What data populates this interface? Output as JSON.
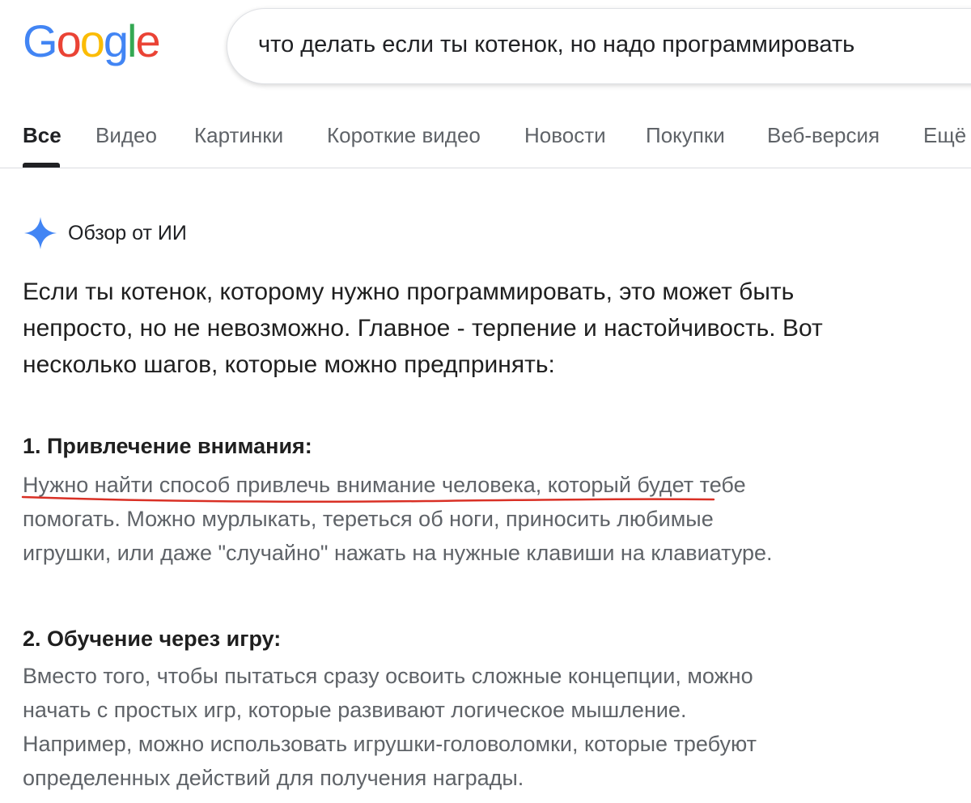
{
  "logo": {
    "letters": [
      "G",
      "o",
      "o",
      "g",
      "l",
      "e"
    ],
    "colors": [
      "#4285F4",
      "#EA4335",
      "#FBBC05",
      "#4285F4",
      "#34A853",
      "#EA4335"
    ]
  },
  "search": {
    "query": "что делать если ты котенок, но надо программировать"
  },
  "tabs": [
    {
      "label": "Все",
      "active": true
    },
    {
      "label": "Видео"
    },
    {
      "label": "Картинки"
    },
    {
      "label": "Короткие видео"
    },
    {
      "label": "Новости"
    },
    {
      "label": "Покупки"
    },
    {
      "label": "Веб-версия"
    },
    {
      "label": "Ещё"
    }
  ],
  "ai_overview": {
    "label": "Обзор от ИИ",
    "icon": "sparkle-icon",
    "intro": "Если ты котенок, которому нужно программировать, это может быть непросто, но не невозможно. Главное - терпение и настойчивость. Вот несколько шагов, которые можно предпринять:",
    "sections": [
      {
        "title": "1. Привлечение внимания:",
        "body": "Нужно найти способ привлечь внимание человека, который будет тебе помогать. Можно мурлыкать, тереться об ноги, приносить любимые игрушки, или даже \"случайно\" нажать на нужные клавиши на клавиатуре."
      },
      {
        "title": "2. Обучение через игру:",
        "body": "Вместо того, чтобы пытаться сразу освоить сложные концепции, можно начать с простых игр, которые развивают логическое мышление. Например, можно использовать игрушки-головоломки, которые требуют определенных действий для получения награды."
      }
    ]
  },
  "colors": {
    "text": "#1f1f1f",
    "muted": "#5f6368",
    "sparkle": "#4285F4",
    "annotation": "#d93025"
  }
}
